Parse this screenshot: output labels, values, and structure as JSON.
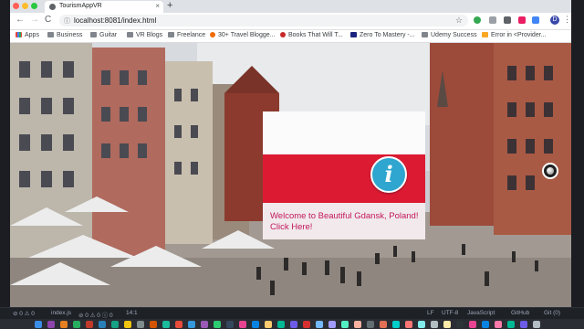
{
  "browser": {
    "tab": {
      "title": "TourismAppVR",
      "close_glyph": "×"
    },
    "new_tab_glyph": "+",
    "address_bar": {
      "url": "localhost:8081/index.html",
      "info_glyph": "ⓘ"
    },
    "profile_initial": "D",
    "nav_glyphs": {
      "back": "←",
      "forward": "→",
      "reload": "C",
      "star": "☆",
      "menu": "⋮"
    }
  },
  "bookmarks": [
    {
      "label": "Apps",
      "icon": "apps-grid-icon"
    },
    {
      "label": "Business",
      "icon": "folder-icon"
    },
    {
      "label": "Guitar",
      "icon": "folder-icon"
    },
    {
      "label": "VR Blogs",
      "icon": "folder-icon"
    },
    {
      "label": "Freelance",
      "icon": "folder-icon"
    },
    {
      "label": "30+ Travel Blogge...",
      "icon": "travel-blog-icon"
    },
    {
      "label": "Books That Will T...",
      "icon": "books-icon"
    },
    {
      "label": "Zero To Mastery -...",
      "icon": "zero-to-mastery-icon"
    },
    {
      "label": "Udemy Success",
      "icon": "folder-icon"
    },
    {
      "label": "Error in <Provider...",
      "icon": "error-page-icon"
    }
  ],
  "scene": {
    "info_letter": "i",
    "welcome_text": "Welcome to Beautiful Gdansk, Poland! Click Here!",
    "flag_colors": {
      "white": "#fbfbfb",
      "red": "#dc1b33"
    },
    "info_color": "#2fa6cf",
    "welcome_color": "#c2185b"
  },
  "statusbar": {
    "problems": "⊘ 0  ⚠ 0",
    "file": "index.js",
    "problems2": "⊘ 0  ⚠ 0  ⓘ 0",
    "position": "14:1",
    "eol": "LF",
    "encoding": "UTF-8",
    "language": "JavaScript",
    "github": "GitHub",
    "git": "Git (0)"
  }
}
